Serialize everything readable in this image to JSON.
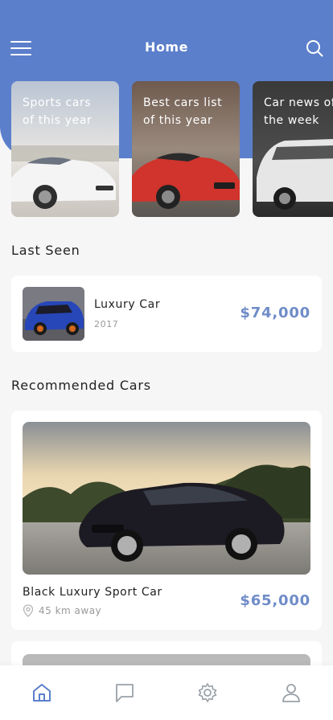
{
  "header": {
    "title": "Home"
  },
  "categories": [
    {
      "label": "Sports cars\nof this year"
    },
    {
      "label": "Best cars list\nof this year"
    },
    {
      "label": "Car news of\nthe week"
    }
  ],
  "last_seen": {
    "title": "Last Seen",
    "item": {
      "name": "Luxury Car",
      "year": "2017",
      "price": "$74,000"
    }
  },
  "recommended": {
    "title": "Recommended Cars",
    "items": [
      {
        "name": "Black Luxury Sport Car",
        "distance": "45 km away",
        "price": "$65,000"
      }
    ]
  },
  "colors": {
    "accent": "#5b7fcb",
    "price": "#6f8cc8",
    "tab_active": "#5b7fcb",
    "tab_inactive": "#9aa0a8"
  },
  "tabbar": {
    "active": "home",
    "icons": [
      "home-icon",
      "chat-icon",
      "settings-icon",
      "profile-icon"
    ]
  }
}
